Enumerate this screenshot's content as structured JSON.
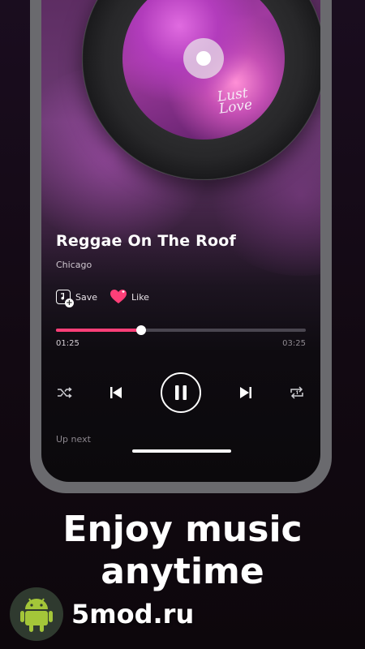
{
  "player": {
    "song_title": "Reggae On The Roof",
    "artist": "Chicago",
    "save_label": "Save",
    "like_label": "Like",
    "current_time": "01:25",
    "total_time": "03:25",
    "progress": 0.34,
    "up_next_label": "Up next",
    "cover_script": "Lust\nLove"
  },
  "icons": {
    "shuffle": "shuffle-icon",
    "previous": "previous-icon",
    "play_pause": "pause-icon",
    "next": "next-icon",
    "repeat": "repeat-one-icon",
    "save": "music-note-plus-icon",
    "like": "heart-icon"
  },
  "colors": {
    "accent": "#ff3f78",
    "like": "#ff3f78"
  },
  "promo": {
    "headline_line1": "Enjoy music",
    "headline_line2": "anytime",
    "watermark": "5mod.ru"
  }
}
